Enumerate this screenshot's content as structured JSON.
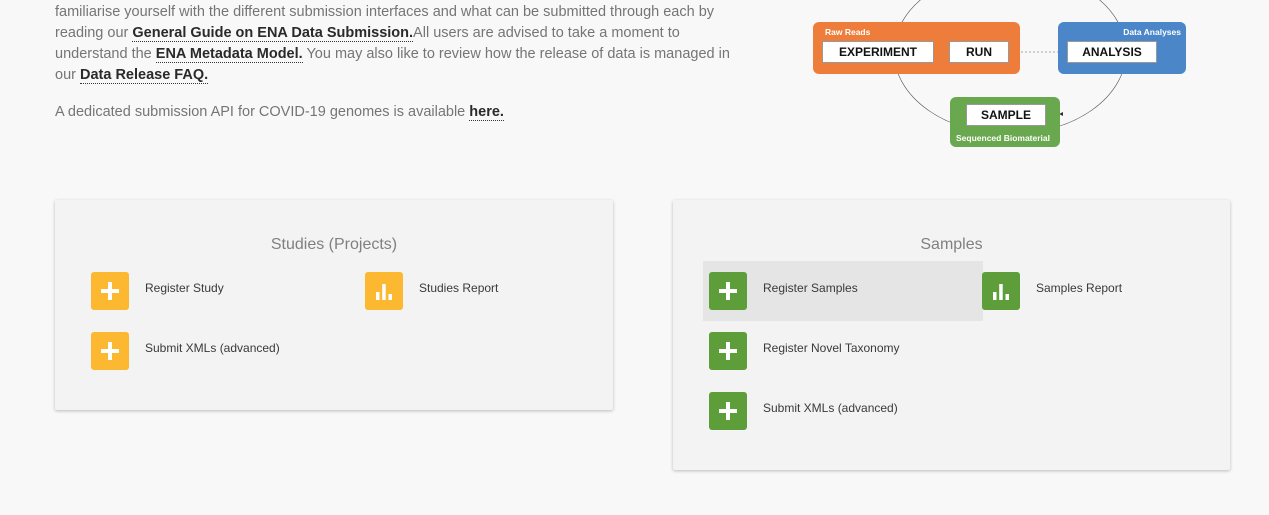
{
  "intro": {
    "line1": "familiarise yourself with the different submission interfaces and what can be submitted through each by reading our ",
    "link_guide": "General Guide on ENA Data Submission.",
    "line2": "All users are advised to take a moment to understand the ",
    "link_model": "ENA Metadata Model.",
    "line3": " You may also like to review how the release of data is managed in our ",
    "link_faq": "Data Release FAQ.",
    "covid_text": "A dedicated submission API for COVID-19 genomes is available ",
    "link_here": "here."
  },
  "diagram": {
    "raw_reads": "Raw Reads",
    "experiment": "EXPERIMENT",
    "run": "RUN",
    "data_analyses": "Data Analyses",
    "analysis": "ANALYSIS",
    "sample": "SAMPLE",
    "sequenced_biomaterial": "Sequenced Biomaterial",
    "colors": {
      "raw": "#ee7d3b",
      "analyses": "#4a86c8",
      "sample": "#6aa84f"
    }
  },
  "studies": {
    "title": "Studies (Projects)",
    "register": "Register Study",
    "report": "Studies Report",
    "submit_xml": "Submit XMLs (advanced)"
  },
  "samples": {
    "title": "Samples",
    "register": "Register Samples",
    "report": "Samples Report",
    "taxonomy": "Register Novel Taxonomy",
    "submit_xml": "Submit XMLs (advanced)"
  }
}
